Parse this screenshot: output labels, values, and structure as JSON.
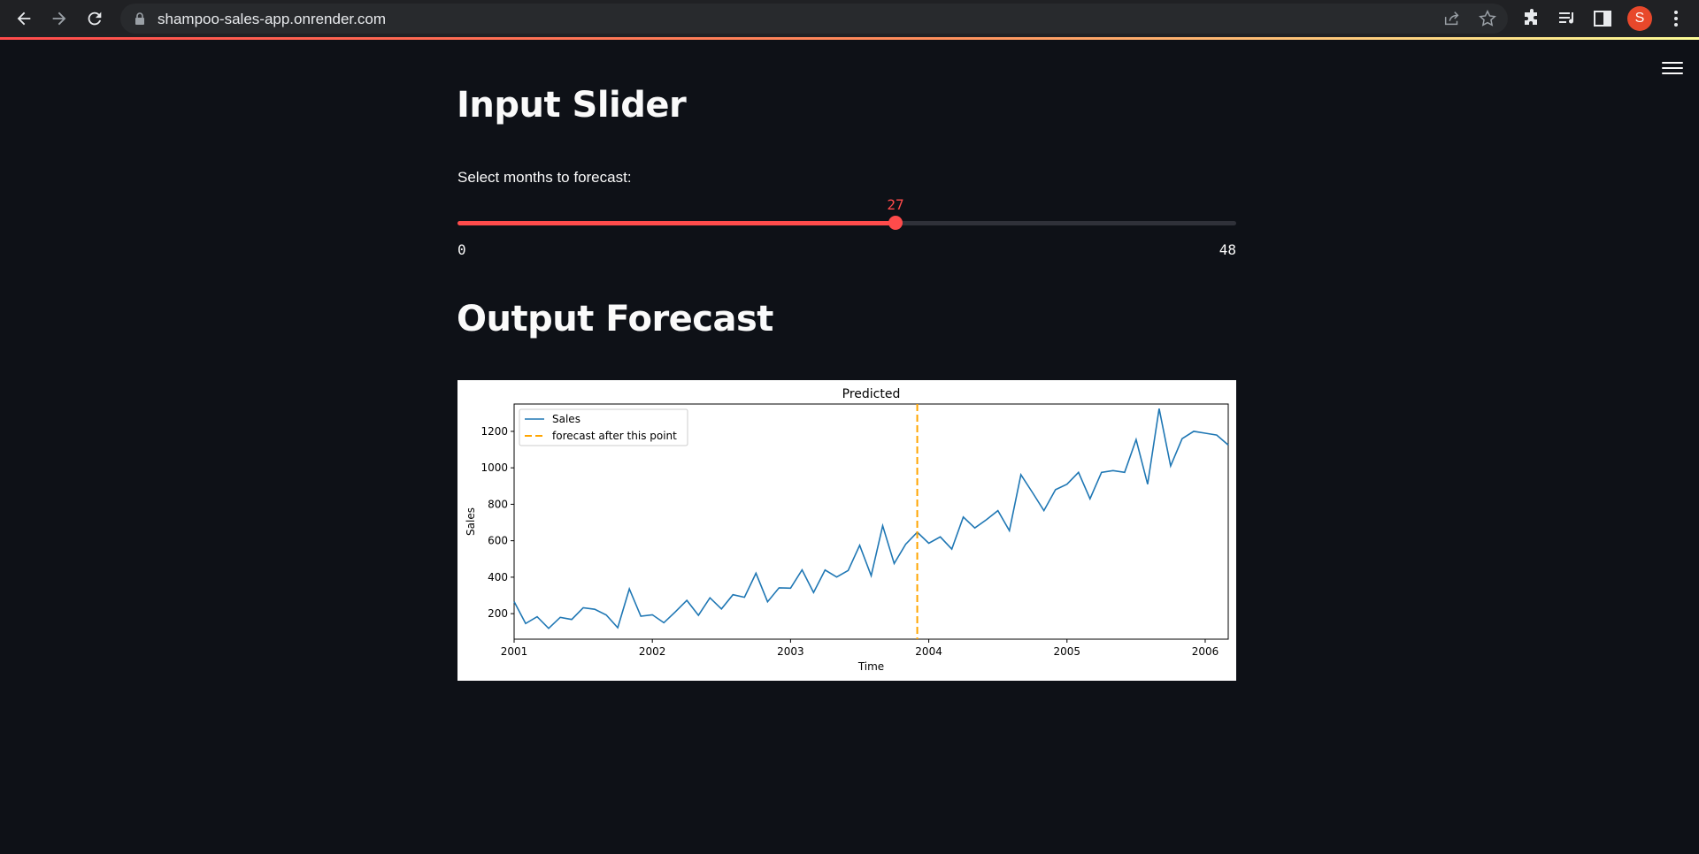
{
  "browser": {
    "url": "shampoo-sales-app.onrender.com",
    "avatar_letter": "S"
  },
  "app": {
    "heading_input": "Input Slider",
    "slider_label": "Select months to forecast:",
    "slider": {
      "min": 0,
      "max": 48,
      "value": 27,
      "min_label": "0",
      "max_label": "48",
      "value_label": "27",
      "color": "#ff4b4b"
    },
    "heading_output": "Output Forecast"
  },
  "chart_data": {
    "type": "line",
    "title": "Predicted",
    "xlabel": "Time",
    "ylabel": "Sales",
    "xlim": [
      "2001-01",
      "2006-03"
    ],
    "ylim": [
      60,
      1350
    ],
    "yticks": [
      200,
      400,
      600,
      800,
      1000,
      1200
    ],
    "xticks": [
      "2001",
      "2002",
      "2003",
      "2004",
      "2005",
      "2006"
    ],
    "legend_placement": "top-left",
    "series": [
      {
        "name": "Sales",
        "color": "#1f77b4",
        "start": "2001-01",
        "frequency": "monthly",
        "values": [
          266,
          146,
          183,
          119,
          180,
          168,
          232,
          224,
          193,
          123,
          336,
          186,
          194,
          150,
          210,
          273,
          191,
          287,
          226,
          304,
          290,
          422,
          265,
          342,
          340,
          440,
          316,
          439,
          401,
          437,
          575,
          408,
          682,
          475,
          581,
          647,
          586,
          621,
          554,
          730,
          670,
          715,
          765,
          655,
          962,
          865,
          765,
          880,
          910,
          975,
          830,
          975,
          985,
          975,
          1155,
          910,
          1325,
          1010,
          1160,
          1200,
          1190,
          1180,
          1125
        ]
      }
    ],
    "vline": {
      "name": "forecast after this point",
      "x": "2003-12",
      "color": "#ffa500",
      "style": "dashed"
    }
  }
}
